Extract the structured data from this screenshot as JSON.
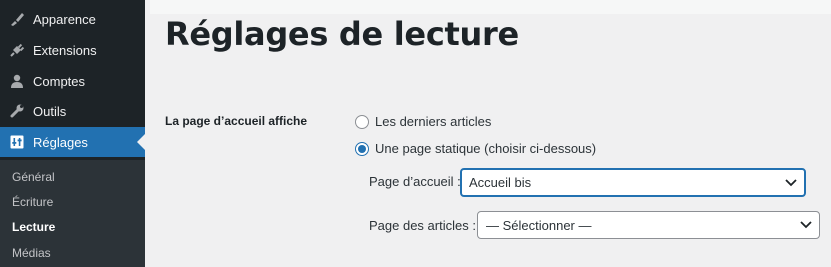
{
  "sidebar": {
    "items": [
      {
        "label": "Apparence",
        "icon": "paintbrush-icon"
      },
      {
        "label": "Extensions",
        "icon": "plugin-icon"
      },
      {
        "label": "Comptes",
        "icon": "users-icon"
      },
      {
        "label": "Outils",
        "icon": "tools-icon"
      },
      {
        "label": "Réglages",
        "icon": "settings-icon",
        "active": true
      }
    ],
    "submenu": [
      {
        "label": "Général"
      },
      {
        "label": "Écriture"
      },
      {
        "label": "Lecture",
        "current": true
      },
      {
        "label": "Médias"
      }
    ]
  },
  "main": {
    "title": "Réglages de lecture",
    "homepage_displays": {
      "label": "La page d’accueil affiche",
      "options": [
        {
          "label": "Les derniers articles",
          "checked": false
        },
        {
          "label": "Une page statique (choisir ci-dessous)",
          "checked": true
        }
      ],
      "homepage_select": {
        "label": "Page d’accueil :",
        "value": "Accueil bis"
      },
      "posts_select": {
        "label": "Page des articles :",
        "value": "— Sélectionner —"
      }
    }
  },
  "colors": {
    "sidebar_bg": "#1d2327",
    "submenu_bg": "#2c3338",
    "accent": "#2271b1",
    "content_bg": "#f0f0f1"
  }
}
